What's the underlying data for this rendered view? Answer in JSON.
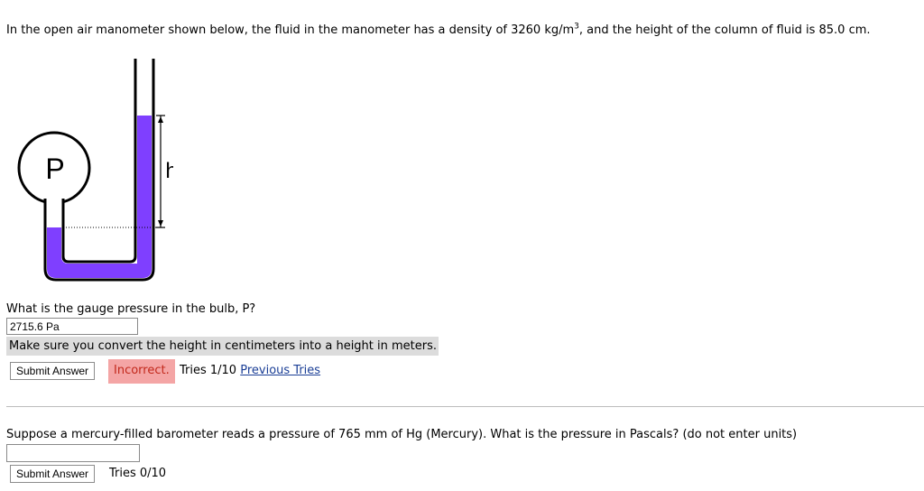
{
  "problem1": {
    "text_before": "In the open air manometer shown below, the fluid in the manometer has a density of 3260 kg/m",
    "superscript": "3",
    "text_after": ", and the height of the column of fluid is 85.0 cm.",
    "diagram": {
      "bulb_label": "P",
      "height_label": "h",
      "fluid_color": "#7f3fff"
    },
    "question": "What is the gauge pressure in the bulb, P?",
    "answer_value": "2715.6 Pa",
    "hint": "Make sure you convert the height in centimeters into a height in meters.",
    "submit_label": "Submit Answer",
    "status": "Incorrect.",
    "tries": "Tries 1/10",
    "previous_tries_link": "Previous Tries"
  },
  "problem2": {
    "question": "Suppose a mercury-filled barometer reads a pressure of 765 mm of Hg (Mercury). What is the pressure in Pascals? (do not enter units)",
    "answer_value": "",
    "submit_label": "Submit Answer",
    "tries": "Tries 0/10"
  },
  "colors": {
    "incorrect_bg": "#f4a5a5",
    "incorrect_text": "#c2281b",
    "hint_bg": "#dcdcdc",
    "link": "#1a3e96"
  }
}
